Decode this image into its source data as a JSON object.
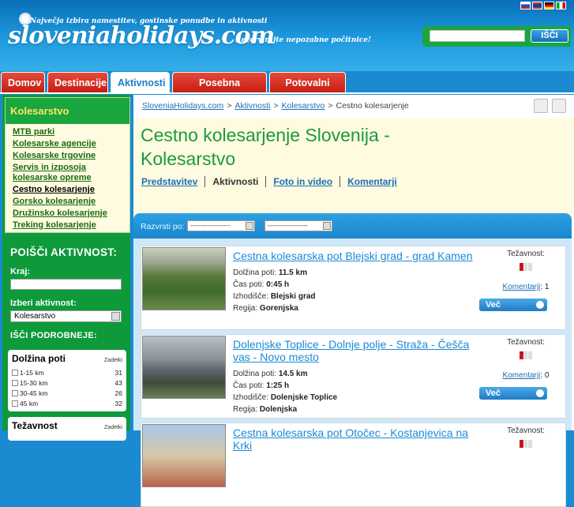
{
  "header": {
    "tagline": "Največja izbira namestitev, gostinske ponudbe in aktivnosti",
    "logo": "sloveniaholidays.com",
    "slogan": "Rezervirajte nepozabne počitnice!",
    "search_button": "IŠČI",
    "search_value": ""
  },
  "tabs": [
    {
      "label": "Domov",
      "width": 56
    },
    {
      "label": "Destinacije",
      "width": 77
    },
    {
      "label": "Aktivnosti",
      "width": 75
    },
    {
      "label": "Posebna ponudba",
      "width": 120
    },
    {
      "label": "Potovalni blog",
      "width": 97
    }
  ],
  "sidebar": {
    "title": "Kolesarstvo",
    "categories": [
      "MTB parki",
      "Kolesarske agencije",
      "Kolesarske trgovine",
      "Servis in izposoja kolesarske opreme",
      "Cestno kolesarjenje",
      "Gorsko kolesarjenje",
      "Družinsko kolesarjenje",
      "Treking kolesarjenje"
    ],
    "selected_category": "Cestno kolesarjenje",
    "finder_title": "POIŠČI AKTIVNOST:",
    "place_label": "Kraj:",
    "place_value": "",
    "activity_label": "Izberi aktivnost:",
    "activity_value": "Kolesarstvo",
    "advanced_label": "IŠČI PODROBNEJE:",
    "length_filter": {
      "title": "Dolžina poti",
      "count_header": "Zadetki",
      "rows": [
        {
          "label": "1-15 km",
          "count": "31"
        },
        {
          "label": "15-30 km",
          "count": "43"
        },
        {
          "label": "30-45 km",
          "count": "26"
        },
        {
          "label": "45 km",
          "count": "32"
        }
      ]
    },
    "difficulty_filter": {
      "title": "Težavnost",
      "count_header": "Zadetki"
    }
  },
  "breadcrumb": {
    "items": [
      "SloveniaHolidays.com",
      "Aktivnosti",
      "Kolesarstvo"
    ],
    "current": "Cestno kolesarjenje",
    "separator": ">"
  },
  "page_title": "Cestno kolesarjenje Slovenija - Kolesarstvo",
  "subtabs": [
    "Predstavitev",
    "Aktivnosti",
    "Foto in video",
    "Komentarji"
  ],
  "sort": {
    "label": "Razvrsti po:",
    "options": [
      "-------------------",
      "-------------------"
    ]
  },
  "labels": {
    "length": "Dolžina poti:",
    "time": "Čas poti:",
    "start": "Izhodišče:",
    "region": "Regija:",
    "difficulty": "Težavnost:",
    "comments": "Komentarji",
    "more": "Več"
  },
  "results": [
    {
      "title": "Cestna kolesarska pot Blejski grad - grad Kamen",
      "length": "11.5 km",
      "time": "0:45 h",
      "start": "Blejski grad",
      "region": "Gorenjska",
      "difficulty": 1,
      "comments": ": 1"
    },
    {
      "title": "Dolenjske Toplice - Dolnje polje - Straža - Češča vas - Novo mesto",
      "length": "14.5 km",
      "time": "1:25 h",
      "start": "Dolenjske Toplice",
      "region": "Dolenjska",
      "difficulty": 1,
      "comments": ": 0"
    },
    {
      "title": "Cestna kolesarska pot Otočec - Kostanjevica na Krki",
      "length": "",
      "time": "",
      "start": "",
      "region": "",
      "difficulty": 1,
      "comments": ""
    }
  ],
  "colors": {
    "header_blue": "#1e9ae0",
    "tab_red": "#c51d12",
    "sidebar_green": "#0e9a3a",
    "title_green": "#1b9a3e",
    "link_blue": "#1b8ad6",
    "cream": "#fffbe0"
  }
}
